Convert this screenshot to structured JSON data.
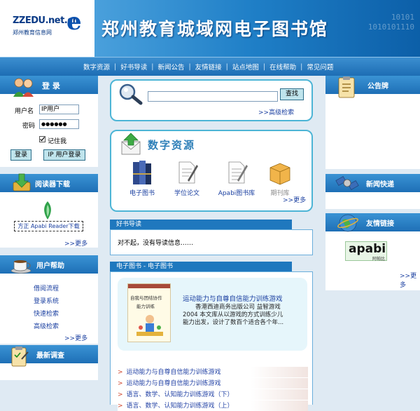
{
  "header": {
    "logo_domain": "ZZEDU.net.cn",
    "logo_sub": "郑州教育信息网",
    "logo_letter": "e",
    "title": "郑州教育城域网电子图书馆",
    "binary_deco_1": "10101",
    "binary_deco_2": "1010101110"
  },
  "nav": {
    "items": [
      "数字资源",
      "好书导读",
      "新闻公告",
      "友情链接",
      "站点地图",
      "在线帮助",
      "常见问题"
    ],
    "separator": "|"
  },
  "login": {
    "title": "登  录",
    "username_label": "用户名",
    "username_value": "IP用户",
    "password_label": "密码",
    "password_value": "●●●●●●",
    "remember_label": "记住我",
    "login_button": "登录",
    "ip_login_button": "IP 用户登录"
  },
  "reader_download": {
    "title": "阅读器下载",
    "link": "方正 Apabi Reader下载",
    "more": ">>更多"
  },
  "user_help": {
    "title": "用户帮助",
    "items": [
      "借阅流程",
      "登录系统",
      "快速检索",
      "高级检索"
    ],
    "more": ">>更多"
  },
  "survey": {
    "title": "最新调查"
  },
  "search": {
    "button": "查找",
    "advanced": ">>高级检索"
  },
  "digital_resources": {
    "title": "数字资源",
    "items": [
      "电子图书",
      "学位论文",
      "Apabi图书库",
      "期刊库"
    ],
    "more": ">>更多"
  },
  "good_books": {
    "tab": "好书导读",
    "message": "对不起，没有导读信息……"
  },
  "ebooks": {
    "tab": "电子图书 - 电子图书",
    "featured": {
      "cover_title_1": "自我与团结协作",
      "cover_title_2": "能力训练",
      "title": "运动能力与自尊自信能力训练游戏",
      "desc": "香港西迪商务出版公司    益智游戏    2004    本文库从以游戏的方式训练少儿能力出发，设计了数百个适合各个年..."
    },
    "list": [
      "运动能力与自尊自信能力训练游戏",
      "运动能力与自尊自信能力训练游戏",
      "语言、数学、认知能力训练游戏（下）",
      "语言、数学、认知能力训练游戏（上）"
    ]
  },
  "announcements": {
    "title": "公告牌"
  },
  "news": {
    "title": "新闻快递"
  },
  "links": {
    "title": "友情链接",
    "logo_text": "apabi",
    "logo_sub": "阿帕比",
    "more": ">>更多"
  }
}
